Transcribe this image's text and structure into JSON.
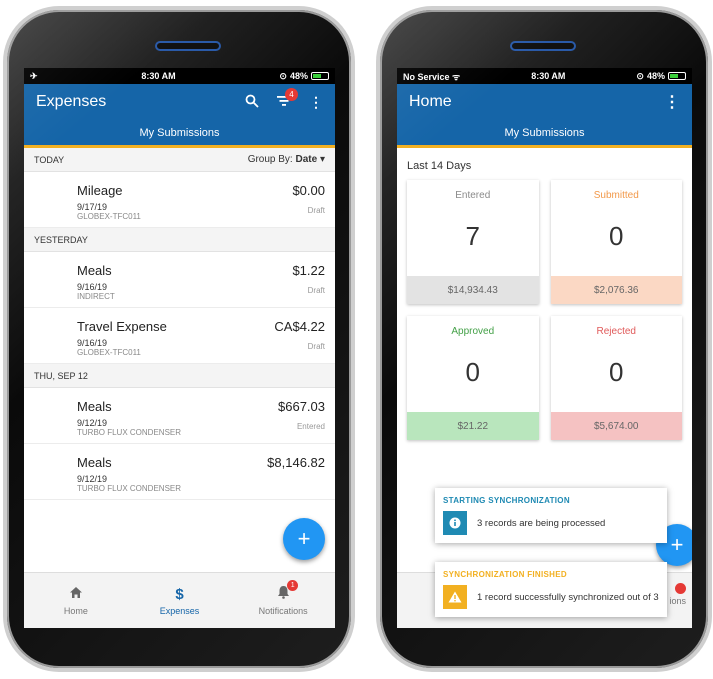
{
  "left_phone": {
    "status": {
      "left": "✈",
      "time": "8:30 AM",
      "battery": "48%"
    },
    "appbar": {
      "title": "Expenses",
      "filter_badge": "4"
    },
    "subbar": "My Submissions",
    "today_header": "TODAY",
    "group_by": {
      "label": "Group By:",
      "value": "Date"
    },
    "sections": [
      {
        "header": "YESTERDAY"
      },
      {
        "header": "THU, SEP 12"
      }
    ],
    "items": [
      {
        "name": "Mileage",
        "amount": "$0.00",
        "date": "9/17/19",
        "project": "GLOBEX-TFC011",
        "status": "Draft"
      },
      {
        "name": "Meals",
        "amount": "$1.22",
        "date": "9/16/19",
        "project": "INDIRECT",
        "status": "Draft"
      },
      {
        "name": "Travel Expense",
        "amount": "CA$4.22",
        "date": "9/16/19",
        "project": "GLOBEX-TFC011",
        "status": "Draft"
      },
      {
        "name": "Meals",
        "amount": "$667.03",
        "date": "9/12/19",
        "project": "TURBO FLUX CONDENSER",
        "status": "Entered"
      },
      {
        "name": "Meals",
        "amount": "$8,146.82",
        "date": "9/12/19",
        "project": "TURBO FLUX CONDENSER",
        "status": ""
      }
    ],
    "fab": "+",
    "nav": [
      {
        "label": "Home",
        "icon": "home-icon"
      },
      {
        "label": "Expenses",
        "icon": "dollar-icon"
      },
      {
        "label": "Notifications",
        "icon": "bell-icon",
        "badge": "1"
      }
    ]
  },
  "right_phone": {
    "status": {
      "left": "No Service",
      "time": "8:30 AM",
      "battery": "48%"
    },
    "appbar": {
      "title": "Home"
    },
    "subbar": "My Submissions",
    "range": "Last 14 Days",
    "cards": [
      {
        "label": "Entered",
        "count": "7",
        "total": "$14,934.43",
        "label_color": "#8a8a8a",
        "total_bg": "#e3e3e3"
      },
      {
        "label": "Submitted",
        "count": "0",
        "total": "$2,076.36",
        "label_color": "#f2994a",
        "total_bg": "#fbd8c4"
      },
      {
        "label": "Approved",
        "count": "0",
        "total": "$21.22",
        "label_color": "#43a047",
        "total_bg": "#b9e6bd"
      },
      {
        "label": "Rejected",
        "count": "0",
        "total": "$5,674.00",
        "label_color": "#e05a5a",
        "total_bg": "#f5c2c2"
      }
    ],
    "toasts": [
      {
        "title": "STARTING SYNCHRONIZATION",
        "message": "3 records are being processed",
        "title_color": "#1f8ab3",
        "icon_bg": "#1f8ab3",
        "icon": "info-icon"
      },
      {
        "title": "SYNCHRONIZATION FINISHED",
        "message": "1 record successfully synchronized out of 3",
        "title_color": "#f2b021",
        "icon_bg": "#f2b021",
        "icon": "warning-icon"
      }
    ],
    "fab": "+",
    "nav_partial": "ions"
  }
}
